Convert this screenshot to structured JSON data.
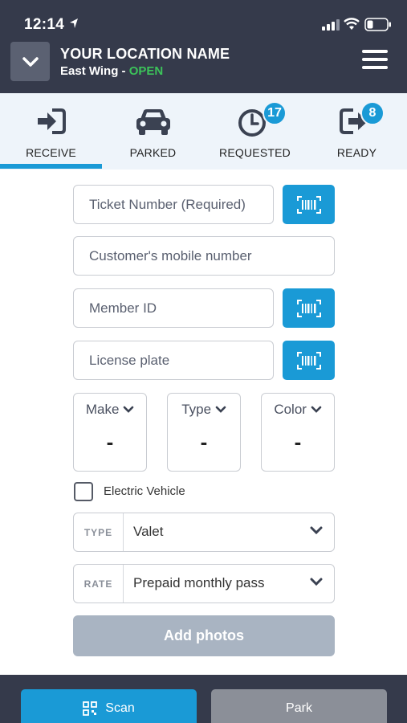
{
  "status_bar": {
    "time": "12:14"
  },
  "header": {
    "location_name": "YOUR LOCATION NAME",
    "sub_prefix": "East Wing - ",
    "status": "OPEN",
    "status_color": "#3cc35a"
  },
  "tabs": [
    {
      "label": "RECEIVE",
      "icon": "sign-in-icon",
      "active": true
    },
    {
      "label": "PARKED",
      "icon": "car-icon"
    },
    {
      "label": "REQUESTED",
      "icon": "clock-icon",
      "badge": "17"
    },
    {
      "label": "READY",
      "icon": "sign-out-icon",
      "badge": "8"
    }
  ],
  "form": {
    "ticket_placeholder": "Ticket Number (Required)",
    "mobile_placeholder": "Customer's mobile number",
    "member_placeholder": "Member ID",
    "plate_placeholder": "License plate",
    "make": {
      "label": "Make",
      "value": "-"
    },
    "type": {
      "label": "Type",
      "value": "-"
    },
    "color": {
      "label": "Color",
      "value": "-"
    },
    "electric_label": "Electric Vehicle",
    "service_type": {
      "prefix": "TYPE",
      "value": "Valet"
    },
    "rate": {
      "prefix": "RATE",
      "value": "Prepaid monthly pass"
    },
    "add_photos": "Add photos"
  },
  "footer": {
    "scan_label": "Scan",
    "park_label": "Park"
  },
  "colors": {
    "accent": "#1a9ad6",
    "header_bg": "#353a4b",
    "disabled": "#a9b4c2"
  }
}
